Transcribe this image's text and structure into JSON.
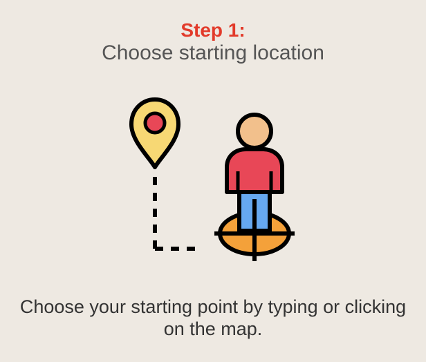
{
  "step": {
    "label": "Step 1:",
    "title": "Choose starting location"
  },
  "illustration": {
    "icons": [
      "map-pin-icon",
      "person-icon",
      "target-icon"
    ],
    "colors": {
      "accent": "#E23A2A",
      "pin_fill": "#F7D874",
      "pin_center": "#E84757",
      "person_head": "#F2C08C",
      "person_shirt": "#E84757",
      "person_pants": "#66A8F0",
      "target_fill": "#F4A13A",
      "outline": "#000000"
    }
  },
  "description": {
    "text": "Choose your starting point by typing or clicking on the map."
  }
}
